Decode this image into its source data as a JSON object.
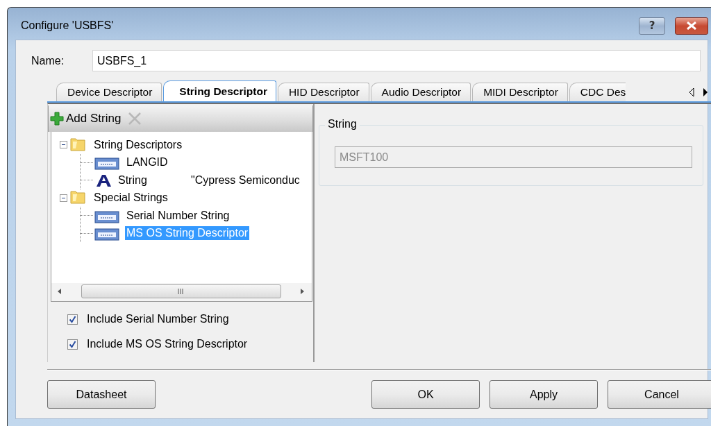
{
  "window": {
    "title": "Configure 'USBFS'",
    "help_button": {
      "label": "?"
    }
  },
  "name_field": {
    "label": "Name:",
    "value": "USBFS_1"
  },
  "tabs": [
    {
      "label": "Device Descriptor",
      "selected": false
    },
    {
      "label": "String Descriptor",
      "selected": true
    },
    {
      "label": "HID Descriptor",
      "selected": false
    },
    {
      "label": "Audio Descriptor",
      "selected": false
    },
    {
      "label": "MIDI Descriptor",
      "selected": false
    },
    {
      "label": "CDC Des",
      "selected": false
    }
  ],
  "toolbar": [
    {
      "kind": "add",
      "label": "Add String",
      "disabled": false
    },
    {
      "kind": "delete",
      "disabled": true
    }
  ],
  "tree": [
    {
      "kind": "folder",
      "label": "String Descriptors",
      "expanded": true,
      "selected": false,
      "children": [
        {
          "kind": "descriptor",
          "label": "LANGID",
          "selected": false
        },
        {
          "kind": "string",
          "label": "String",
          "value": "\"Cypress Semiconduc",
          "selected": false
        }
      ]
    },
    {
      "kind": "folder",
      "label": "Special Strings",
      "expanded": true,
      "selected": false,
      "children": [
        {
          "kind": "descriptor",
          "label": "Serial Number String",
          "selected": false
        },
        {
          "kind": "descriptor",
          "label": "MS OS String Descriptor",
          "selected": true
        }
      ]
    }
  ],
  "checkboxes": [
    {
      "label": "Include Serial Number String",
      "checked": true
    },
    {
      "label": "Include MS OS String Descriptor",
      "checked": true
    }
  ],
  "string_group": {
    "title": "String",
    "value": "MSFT100",
    "disabled": true
  },
  "footer": {
    "left": [
      "Datasheet"
    ],
    "right": [
      "OK",
      "Apply",
      "Cancel"
    ]
  }
}
